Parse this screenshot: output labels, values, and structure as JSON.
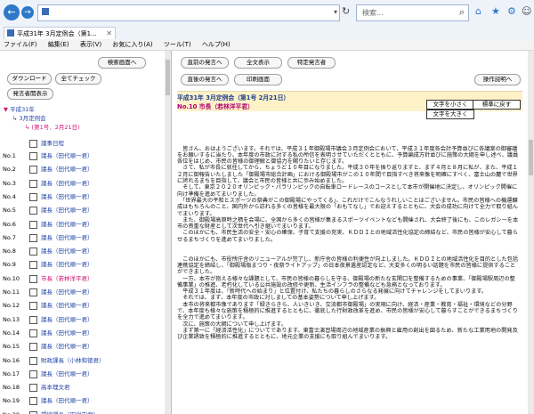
{
  "browser": {
    "search_placeholder": "検索...",
    "tab_title": "平成31年 3月定例会（第1...",
    "menu": [
      "ファイル(F)",
      "編集(E)",
      "表示(V)",
      "お気に入り(A)",
      "ツール(T)",
      "ヘルプ(H)"
    ]
  },
  "left": {
    "buttons": {
      "search_screen": "検索画面へ",
      "download": "ダウンロード",
      "check_all": "全てチェック",
      "speakers": "発言者開表示"
    },
    "tree": {
      "year": "平成31年",
      "session": "3月定例会",
      "day": "(第1号．2月21日)"
    },
    "agenda": "議事日程",
    "rows": [
      {
        "no": "No.1",
        "name": "議長（田代順一君）"
      },
      {
        "no": "No.2",
        "name": "議長（田代順一君）"
      },
      {
        "no": "No.3",
        "name": "議長（田代順一君）"
      },
      {
        "no": "No.4",
        "name": "議長（田代順一君）"
      },
      {
        "no": "No.5",
        "name": "議長（田代順一君）"
      },
      {
        "no": "No.6",
        "name": "議長（田代順一君）"
      },
      {
        "no": "No.7",
        "name": "議長（田代順一君）"
      },
      {
        "no": "No.8",
        "name": "議長（田代順一君）"
      },
      {
        "no": "No.9",
        "name": "議長（田代順一君）"
      },
      {
        "no": "No.10",
        "name": "市長（若林洋平君）",
        "highlight": true
      },
      {
        "no": "No.11",
        "name": "議長（田代順一君）"
      },
      {
        "no": "No.12",
        "name": "議長（田代順一君）"
      },
      {
        "no": "No.13",
        "name": "議長（田代順一君）"
      },
      {
        "no": "No.14",
        "name": "議長（田代順一君）"
      },
      {
        "no": "No.15",
        "name": "議長（田代順一君）"
      },
      {
        "no": "No.16",
        "name": "財政課長（小林和徳君）"
      },
      {
        "no": "No.17",
        "name": "議長（田代順一君）"
      },
      {
        "no": "No.18",
        "name": "高本理文君"
      },
      {
        "no": "No.19",
        "name": "議長（田代順一君）"
      },
      {
        "no": "No.20",
        "name": "環境課長（田代宏君）"
      }
    ]
  },
  "right": {
    "buttons": {
      "prev_speech": "直前の発言へ",
      "show_all": "全文表示",
      "specific_speaker": "特定発言者",
      "next_speech": "直後の発言へ",
      "print": "印刷画面",
      "help": "操作説明へ"
    },
    "head_title": "平成31年 3月定例会（第1号 2月21日）",
    "head_speaker": "No.10 市長（若林洋平君）",
    "font_buttons": {
      "smaller": "文字を小さく",
      "standard": "標準に戻す",
      "larger": "文字を大きく"
    },
    "speech": "　皆さん、おはようございます。それでは、平成３１年御殿場市議会３月定例会において、平成３１年度各会計予算並びに各議案の御審議をお願いするに当たり、本年度の市政に対する私の所信を表明させていただくとともに、予算編成方針並びに施策の大綱を申し述べ、議員各位をはじめ、市民の皆様の御理解と御協力を賜りたいと存じます。\n　さて、私が市長に就任してから、ちょうど１０年目になりました。平成３０年を振り返りますと、まず４月と８月に私が、また、平成１２月に御報告いたしました「御殿場市総合計画」における御殿場市がこの１０年間で目指すべき将来像を明確にすべく、富士山の麓で世界に誇れるまちを目指して、議会と市民の皆様と共に歩み始めました。\n　そして、東京２０２０オリンピック・パラリンピックの自転車ロードレースのコースとして本市が開催地に決定し、オリンピック開催に向け準備を進めてまいりました。\n　「世界最大の平和とスポーツの祭典がこの御殿場にやってくる」、これだけでこんなうれしいことはございません。市民の皆様への機運醸成はもちろんのこと、国内外から訪れる多くの皆様を最大限の「おもてなし」でお迎えするとともに、大会の成功に向けて全力で取り組んでまいります。\n　また、御殿場高原時之栖を会場に、全国から多くの皆様が集まるスポーツイベントなども開催され、大会終了後にも、このレガシーを本市の貴重な財産として次世代へ引き継いでまいります。\n　このほかにも、市民生活の安全・安心の確保、子育て支援の充実、ＫＤＤＩとの地域活性化協定の締結など、市民の皆様が安心して暮らせるまちづくりを進めてまいりました。",
    "speech2": "　このほかにも、市役所庁舎のリニューアルが完了し、新庁舎の皆様の利便性が向上しました。ＫＤＤＩとの地域活性化を目的とした包括連携協定を締結し、「御殿場版まつり・夜祭ライトアップ」の日本夜景遺産認定など、大変多くの明るい話題を市民の皆様に提供することができました。\n　一方、本市が抱える様々な課題として、市民の皆様の暮らしを守る、御殿場の新たな玄関口を整備するための事業、「御殿場駅周辺の整備事業」の推進、老朽化している公共施設の改修や更新、生活インフラの整備なども急務となっております。\n　平成３１年度は、「新時代への始まり」と位置付け、私たちの暮らしのさらなる発展に向けてチャレンジをしてまいります。\n　それでは、まず、本年度の市政に対しましての基本姿勢について申し上げます。\n　本市の将来都市像であります「緑きらきら、人いきいき、交流都市御殿場」の実現に向け、経済・産業・教育・福祉・環境などの分野で、本年度も様々な施策を積極的に推進するとともに、徹底した行財政改革を進め、市民の皆様が安心して暮らすことができるまちづくりを全力で進めてまいります。\n　次に、施策の大綱について申し上げます。\n　まず第一に「経済活性化」についてであります。東富士演習場周辺の地域産業の振興と雇用の創出を図るため、新たな工業用地の開発及び企業誘致を積極的に推進するとともに、地元企業の支援にも取り組んでまいります。"
  }
}
